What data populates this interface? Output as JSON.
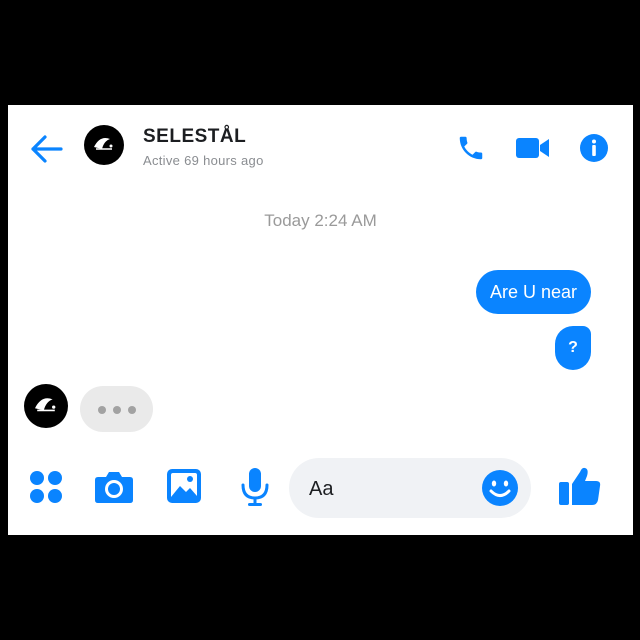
{
  "header": {
    "contact_name": "SELESTÅL",
    "status": "Active 69 hours ago",
    "back_icon": "arrow-left-icon",
    "actions": [
      "phone-icon",
      "video-camera-icon",
      "info-icon"
    ]
  },
  "conversation": {
    "timestamp": "Today 2:24 AM",
    "messages": [
      {
        "direction": "outgoing",
        "text": "Are U near"
      },
      {
        "direction": "outgoing",
        "text": "?"
      }
    ],
    "typing_indicator": true
  },
  "composer": {
    "placeholder": "Aa",
    "tools": [
      "apps-grid-icon",
      "camera-icon",
      "gallery-icon",
      "microphone-icon"
    ],
    "emoji_icon": "smiley-icon",
    "send_icon": "thumbs-up-icon"
  },
  "colors": {
    "accent": "#0a84ff",
    "outgoing_bubble": "#0a84ff",
    "typing_bubble": "#eaeaea",
    "input_background": "#f0f2f5",
    "muted_text": "#8a8d91"
  }
}
